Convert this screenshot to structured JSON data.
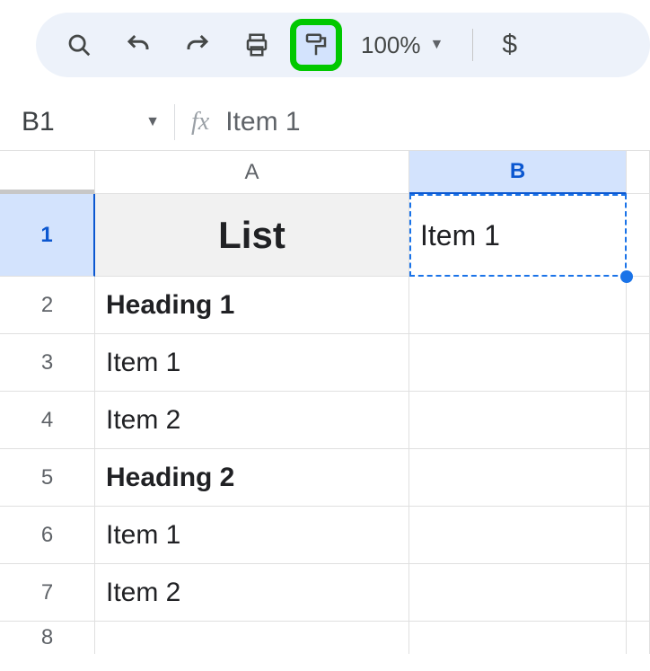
{
  "toolbar": {
    "zoom_label": "100%",
    "currency_label": "$"
  },
  "namebar": {
    "cell_ref": "B1",
    "fx_label": "fx",
    "formula_value": "Item 1"
  },
  "columns": {
    "a": "A",
    "b": "B"
  },
  "rows": {
    "r1": "1",
    "r2": "2",
    "r3": "3",
    "r4": "4",
    "r5": "5",
    "r6": "6",
    "r7": "7",
    "r8": "8"
  },
  "cells": {
    "a1": "List",
    "b1": "Item 1",
    "a2": "Heading 1",
    "a3": "Item 1",
    "a4": "Item 2",
    "a5": "Heading 2",
    "a6": "Item 1",
    "a7": "Item 2"
  }
}
